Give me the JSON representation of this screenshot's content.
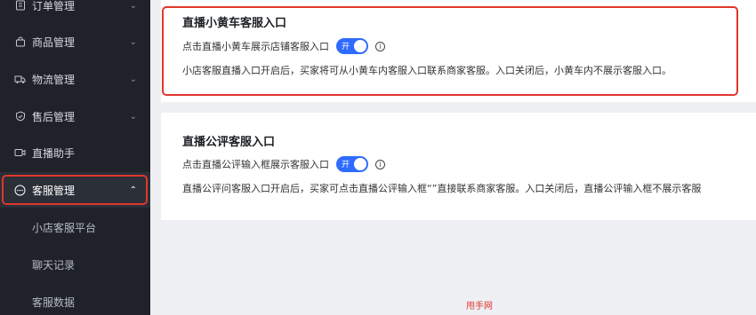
{
  "sidebar": {
    "items": [
      {
        "label": "订单管理",
        "icon": "order-icon",
        "chevron": "⌄"
      },
      {
        "label": "商品管理",
        "icon": "bag-icon",
        "chevron": "⌄"
      },
      {
        "label": "物流管理",
        "icon": "truck-icon",
        "chevron": "⌄"
      },
      {
        "label": "售后管理",
        "icon": "shield-icon",
        "chevron": "⌄"
      },
      {
        "label": "直播助手",
        "icon": "camera-icon",
        "chevron": ""
      },
      {
        "label": "客服管理",
        "icon": "chat-icon",
        "chevron": "⌃"
      }
    ],
    "sub_items": [
      {
        "label": "小店客服平台"
      },
      {
        "label": "聊天记录"
      },
      {
        "label": "客服数据"
      }
    ]
  },
  "sections": [
    {
      "title": "直播小黄车客服入口",
      "toggle_label": "点击直播小黄车展示店铺客服入口",
      "toggle_text": "开",
      "info": "i",
      "description": "小店客服直播入口开启后，买家将可从小黄车内客服入口联系商家客服。入口关闭后，小黄车内不展示客服入口。"
    },
    {
      "title": "直播公评客服入口",
      "toggle_label": "点击直播公评输入框展示客服入口",
      "toggle_text": "开",
      "info": "i",
      "description": "直播公评问客服入口开启后，买家可点击直播公评输入框“”直接联系商家客服。入口关闭后，直播公评输入框不展示客服"
    }
  ],
  "watermark": "甩手网",
  "colors": {
    "accent": "#2f6bff",
    "highlight": "#e0362c",
    "sidebar_bg": "#1f2329"
  }
}
